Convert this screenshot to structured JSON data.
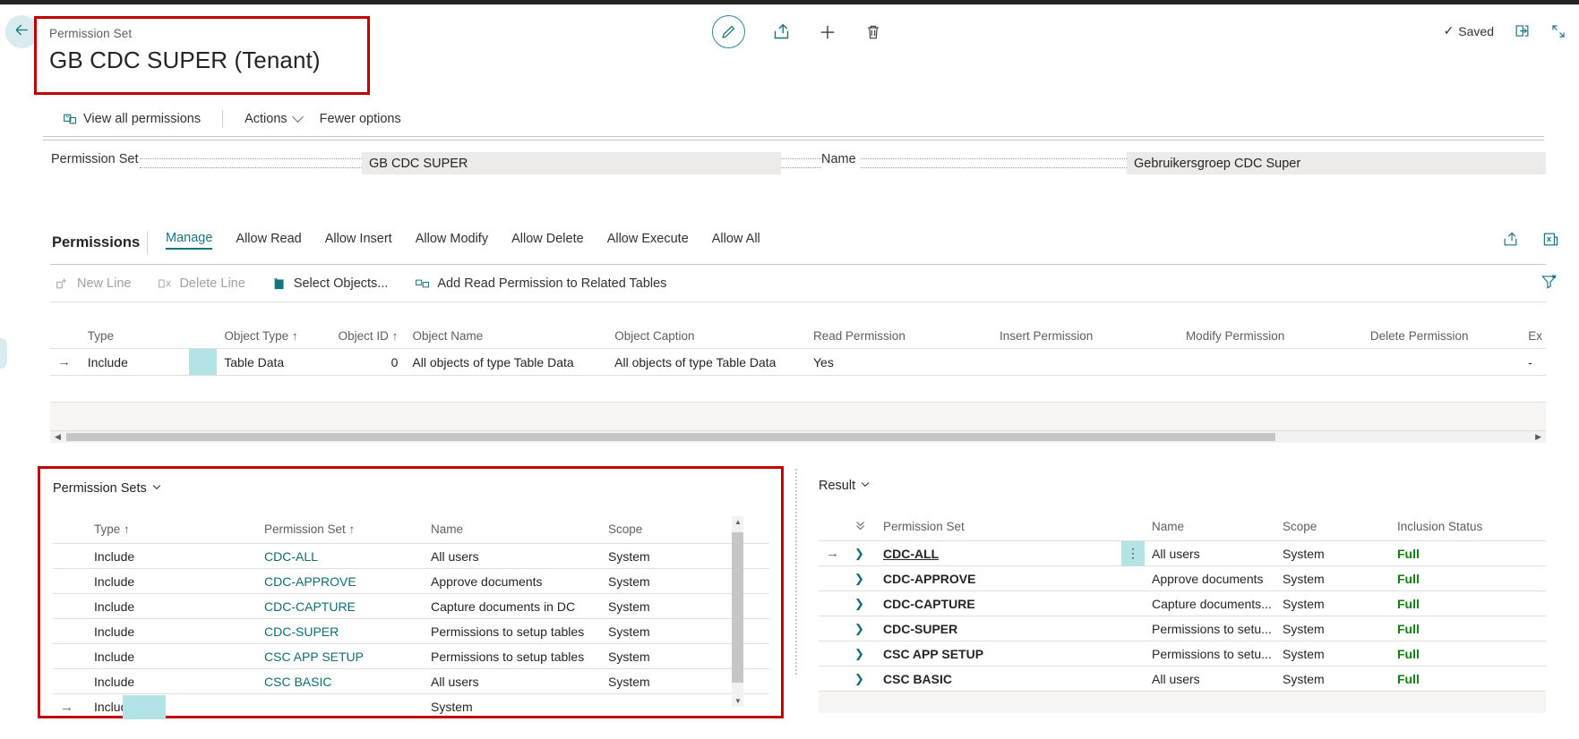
{
  "header": {
    "back_icon": "back-arrow-icon",
    "caption": "Permission Set",
    "title": "GB CDC SUPER (Tenant)",
    "icons": [
      {
        "name": "edit-pencil-icon",
        "label": "Edit"
      },
      {
        "name": "share-icon",
        "label": "Share"
      },
      {
        "name": "plus-icon",
        "label": "New"
      },
      {
        "name": "trash-icon",
        "label": "Delete"
      }
    ],
    "saved_label": "Saved",
    "saved_check": "✓",
    "open_in_new_icon": "open-in-new-window-icon",
    "collapse_icon": "collapse-icon",
    "accent_color": "#15757f",
    "highlight_border_color": "#c00000"
  },
  "commandbar": {
    "view_all_permissions": "View all permissions",
    "actions": "Actions",
    "fewer_options": "Fewer options"
  },
  "fields": {
    "permission_set_label": "Permission Set",
    "permission_set_value": "GB CDC SUPER",
    "name_label": "Name",
    "name_value": "Gebruikersgroep CDC Super"
  },
  "permissions_section": {
    "title": "Permissions",
    "tabs": [
      {
        "label": "Manage",
        "active": true
      },
      {
        "label": "Allow Read",
        "active": false
      },
      {
        "label": "Allow Insert",
        "active": false
      },
      {
        "label": "Allow Modify",
        "active": false
      },
      {
        "label": "Allow Delete",
        "active": false
      },
      {
        "label": "Allow Execute",
        "active": false
      },
      {
        "label": "Allow All",
        "active": false
      }
    ],
    "right_icons": [
      "share-icon",
      "open-in-excel-icon"
    ],
    "subbar": [
      {
        "label": "New Line",
        "icon": "new-line-icon",
        "disabled": true
      },
      {
        "label": "Delete Line",
        "icon": "delete-line-icon",
        "disabled": true
      },
      {
        "label": "Select Objects...",
        "icon": "select-objects-icon",
        "disabled": false
      },
      {
        "label": "Add Read Permission to Related Tables",
        "icon": "add-read-permission-icon",
        "disabled": false
      }
    ],
    "subbar_right_icon": "filter-settings-icon"
  },
  "main_grid": {
    "columns": [
      "Type",
      "Object Type ↑",
      "Object ID ↑",
      "Object Name",
      "Object Caption",
      "Read Permission",
      "Insert Permission",
      "Modify Permission",
      "Delete Permission",
      "Ex"
    ],
    "rows": [
      {
        "selected": true,
        "type": "Include",
        "object_type": "Table Data",
        "object_id": "0",
        "object_name": "All objects of type Table Data",
        "object_caption": "All objects of type Table Data",
        "read": "Yes",
        "insert": "",
        "modify": "",
        "delete": "",
        "ex": "-"
      }
    ]
  },
  "permission_sets_panel": {
    "title": "Permission Sets",
    "columns": [
      "Type ↑",
      "Permission Set ↑",
      "Name",
      "Scope"
    ],
    "rows": [
      {
        "type": "Include",
        "permission_set": "CDC-ALL",
        "name": "All users",
        "scope": "System"
      },
      {
        "type": "Include",
        "permission_set": "CDC-APPROVE",
        "name": "Approve documents",
        "scope": "System"
      },
      {
        "type": "Include",
        "permission_set": "CDC-CAPTURE",
        "name": "Capture documents in DC",
        "scope": "System"
      },
      {
        "type": "Include",
        "permission_set": "CDC-SUPER",
        "name": "Permissions to setup tables",
        "scope": "System"
      },
      {
        "type": "Include",
        "permission_set": "CSC APP SETUP",
        "name": "Permissions to setup tables",
        "scope": "System"
      },
      {
        "type": "Include",
        "permission_set": "CSC BASIC",
        "name": "All users",
        "scope": "System"
      },
      {
        "type": "Include",
        "permission_set": "",
        "name": "",
        "scope": "System"
      }
    ]
  },
  "result_panel": {
    "title": "Result",
    "columns": [
      "Permission Set",
      "Name",
      "Scope",
      "Inclusion Status"
    ],
    "rows": [
      {
        "permission_set": "CDC-ALL",
        "name": "All users",
        "scope": "System",
        "status": "Full",
        "selected": true
      },
      {
        "permission_set": "CDC-APPROVE",
        "name": "Approve documents",
        "scope": "System",
        "status": "Full",
        "selected": false
      },
      {
        "permission_set": "CDC-CAPTURE",
        "name": "Capture documents...",
        "scope": "System",
        "status": "Full",
        "selected": false
      },
      {
        "permission_set": "CDC-SUPER",
        "name": "Permissions to setu...",
        "scope": "System",
        "status": "Full",
        "selected": false
      },
      {
        "permission_set": "CSC APP SETUP",
        "name": "Permissions to setu...",
        "scope": "System",
        "status": "Full",
        "selected": false
      },
      {
        "permission_set": "CSC BASIC",
        "name": "All users",
        "scope": "System",
        "status": "Full",
        "selected": false
      }
    ]
  }
}
